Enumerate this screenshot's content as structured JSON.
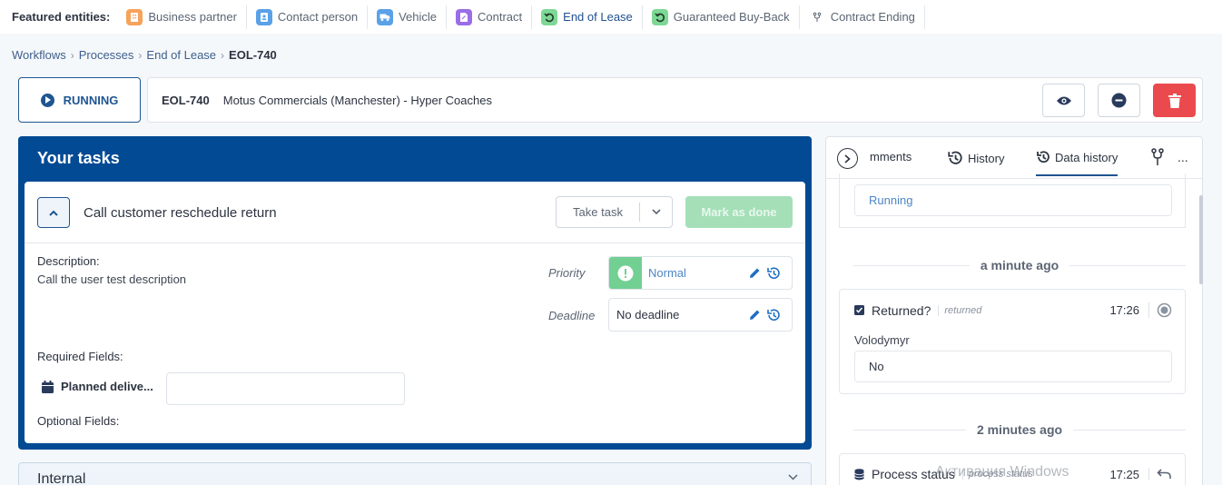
{
  "featured": {
    "label": "Featured entities:",
    "items": [
      {
        "label": "Business partner",
        "color": "#f6a35c",
        "icon": "building-icon"
      },
      {
        "label": "Contact person",
        "color": "#5aa1e8",
        "icon": "contact-card-icon"
      },
      {
        "label": "Vehicle",
        "color": "#5aa1e8",
        "icon": "truck-icon"
      },
      {
        "label": "Contract",
        "color": "#9b6ee8",
        "icon": "contract-icon"
      },
      {
        "label": "End of Lease",
        "color": "#7ed895",
        "icon": "undo-arrow-icon"
      },
      {
        "label": "Guaranteed Buy-Back",
        "color": "#7ed895",
        "icon": "undo-arrow-icon"
      },
      {
        "label": "Contract Ending",
        "color": "",
        "icon": "fork-icon"
      }
    ]
  },
  "breadcrumb": [
    "Workflows",
    "Processes",
    "End of Lease",
    "EOL-740"
  ],
  "header": {
    "status": "RUNNING",
    "code": "EOL-740",
    "name": "Motus Commercials (Manchester) - Hyper Coaches"
  },
  "tasks": {
    "title": "Your tasks",
    "task": {
      "name": "Call customer reschedule return",
      "take_task": "Take task",
      "mark_done": "Mark as done",
      "description_label": "Description:",
      "description": "Call the user test description",
      "priority_label": "Priority",
      "priority_value": "Normal",
      "deadline_label": "Deadline",
      "deadline_value": "No deadline",
      "required_label": "Required Fields:",
      "planned_label": "Planned delive...",
      "optional_label": "Optional Fields:"
    }
  },
  "internal": {
    "label": "Internal"
  },
  "right_panel": {
    "tabs": [
      "mments",
      "History",
      "Data history"
    ],
    "more": "...",
    "card1_value": "Running",
    "divider1": "a minute ago",
    "card2": {
      "title": "Returned?",
      "sub": "returned",
      "time": "17:26",
      "user": "Volodymyr",
      "value": "No"
    },
    "divider2": "2 minutes ago",
    "card3": {
      "title": "Process status",
      "sub": "process status",
      "time": "17:25"
    }
  },
  "watermark": "Активация Windows"
}
